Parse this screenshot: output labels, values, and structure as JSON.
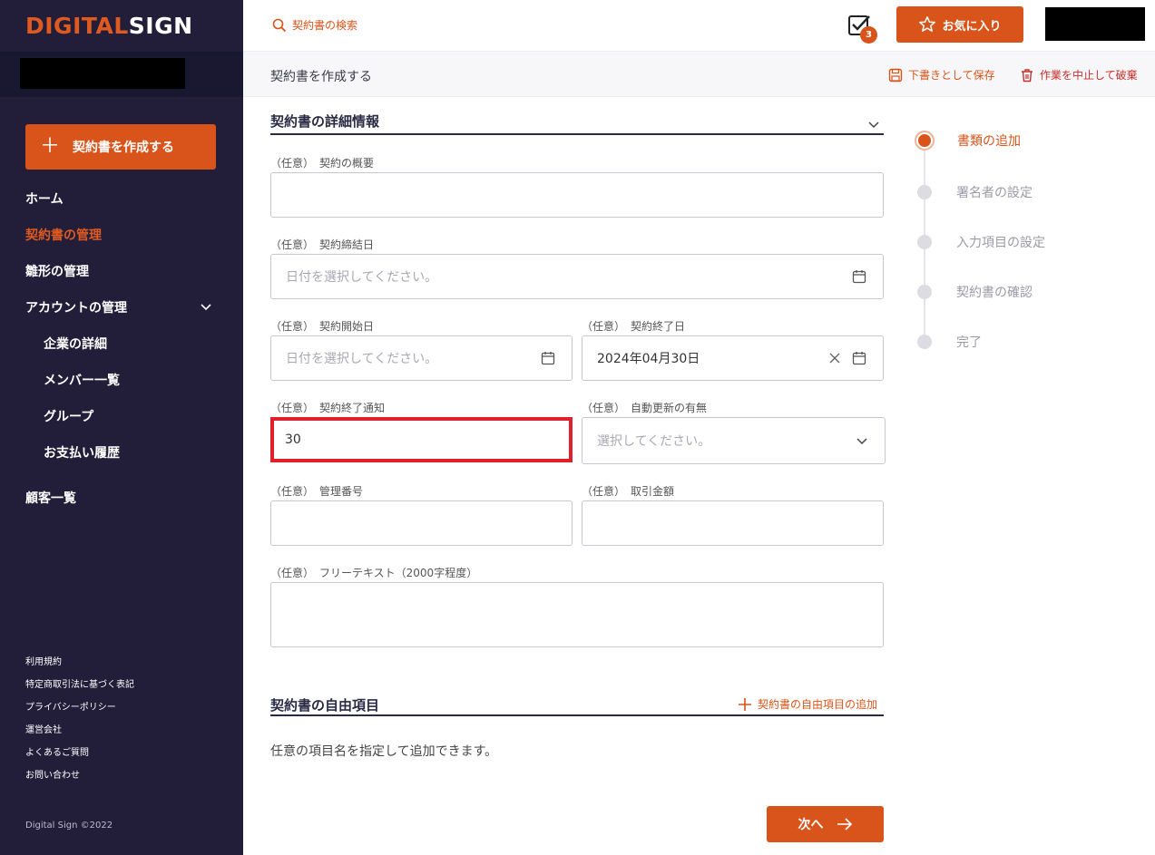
{
  "brand": {
    "logo_part1": "DIGIT",
    "logo_part2": "AL",
    "logo_part3": "SIGN"
  },
  "sidebar": {
    "create_label": "契約書を作成する",
    "items": [
      {
        "label": "ホーム"
      },
      {
        "label": "契約書の管理"
      },
      {
        "label": "雛形の管理"
      },
      {
        "label": "アカウントの管理"
      },
      {
        "label": "企業の詳細"
      },
      {
        "label": "メンバー一覧"
      },
      {
        "label": "グループ"
      },
      {
        "label": "お支払い履歴"
      },
      {
        "label": "顧客一覧"
      }
    ],
    "footer_links": [
      "利用規約",
      "特定商取引法に基づく表記",
      "プライバシーポリシー",
      "運営会社",
      "よくあるご質問",
      "お問い合わせ"
    ],
    "copyright": "Digital Sign ©2022"
  },
  "topbar": {
    "search_label": "契約書の検索",
    "task_count": "3",
    "favorite_label": "お気に入り"
  },
  "subheader": {
    "title": "契約書を作成する",
    "save_draft": "下書きとして保存",
    "discard": "作業を中止して破棄"
  },
  "form": {
    "section_title": "契約書の詳細情報",
    "optional": "（任意）",
    "fields": {
      "summary": {
        "label": "契約の概要",
        "value": ""
      },
      "conclusion_date": {
        "label": "契約締結日",
        "placeholder": "日付を選択してください。"
      },
      "start_date": {
        "label": "契約開始日",
        "placeholder": "日付を選択してください。"
      },
      "end_date": {
        "label": "契約終了日",
        "value": "2024年04月30日"
      },
      "end_notice": {
        "label": "契約終了通知",
        "value": "30"
      },
      "auto_renew": {
        "label": "自動更新の有無",
        "placeholder": "選択してください。"
      },
      "management_no": {
        "label": "管理番号",
        "value": ""
      },
      "amount": {
        "label": "取引金額",
        "value": ""
      },
      "free_text": {
        "label": "フリーテキスト（2000字程度）",
        "value": ""
      }
    },
    "free_section_title": "契約書の自由項目",
    "free_add_label": "契約書の自由項目の追加",
    "free_desc": "任意の項目名を指定して追加できます。",
    "next_label": "次へ"
  },
  "stepper": {
    "steps": [
      "書類の追加",
      "署名者の設定",
      "入力項目の設定",
      "契約書の確認",
      "完了"
    ]
  },
  "colors": {
    "accent": "#d9541a",
    "sidebar_bg": "#221e39",
    "focus_border": "#e0202a"
  }
}
